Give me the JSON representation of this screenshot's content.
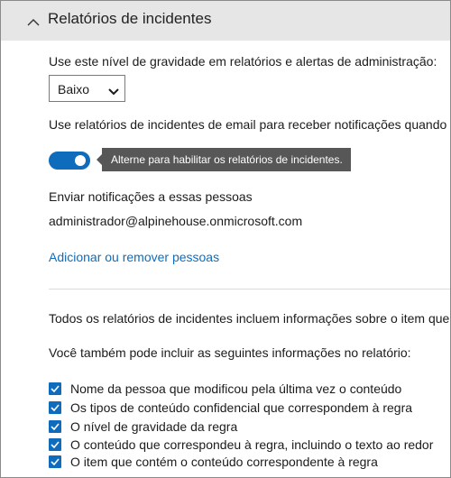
{
  "section": {
    "title": "Relatórios de incidentes",
    "expanded": true,
    "chevron_icon": "chevron-up-icon"
  },
  "severity": {
    "label": "Use este nível de gravidade em relatórios e alertas de administração:",
    "selected": "Baixo",
    "caret_icon": "chevron-down-icon"
  },
  "email_reports": {
    "label": "Use relatórios de incidentes de email para receber notificações quando o",
    "toggle_on": true,
    "tooltip": "Alterne para habilitar os relatórios de incidentes."
  },
  "recipients": {
    "label": "Enviar notificações a essas pessoas",
    "email": "administrador@alpinehouse.onmicrosoft.com",
    "add_remove_link": "Adicionar ou remover pessoas"
  },
  "report_info": {
    "intro": "Todos os relatórios de incidentes incluem informações sobre o item que",
    "also_include": "Você também pode incluir as seguintes informações no relatório:",
    "options": [
      {
        "label": "Nome da pessoa que modificou pela última vez o conteúdo",
        "checked": true
      },
      {
        "label": "Os tipos de conteúdo confidencial que correspondem à regra",
        "checked": true
      },
      {
        "label": "O nível de gravidade da regra",
        "checked": true
      },
      {
        "label": "O conteúdo que correspondeu à regra, incluindo o texto ao redor",
        "checked": true
      },
      {
        "label": "O item que contém o conteúdo correspondente à regra",
        "checked": true
      }
    ]
  },
  "colors": {
    "accent": "#0f6cbd",
    "header_bg": "#e6e6e6",
    "tooltip_bg": "#575757"
  }
}
